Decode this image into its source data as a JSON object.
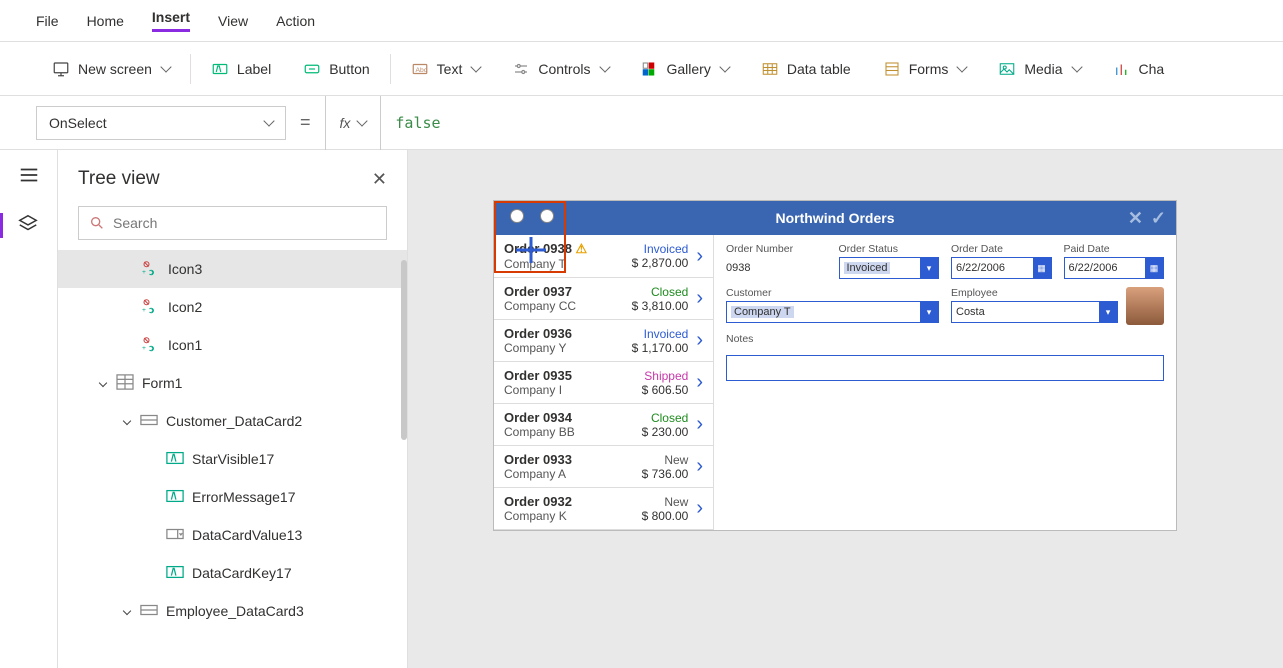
{
  "menu": {
    "items": [
      "File",
      "Home",
      "Insert",
      "View",
      "Action"
    ],
    "active_index": 2
  },
  "ribbon": {
    "new_screen": "New screen",
    "label": "Label",
    "button": "Button",
    "text": "Text",
    "controls": "Controls",
    "gallery": "Gallery",
    "data_table": "Data table",
    "forms": "Forms",
    "media": "Media",
    "charts": "Cha"
  },
  "formula": {
    "property": "OnSelect",
    "fx": "fx",
    "value": "false"
  },
  "tree": {
    "title": "Tree view",
    "search_placeholder": "Search",
    "items": [
      {
        "label": "Icon3",
        "depth": 2,
        "icon": "icon",
        "sel": true
      },
      {
        "label": "Icon2",
        "depth": 2,
        "icon": "icon"
      },
      {
        "label": "Icon1",
        "depth": 2,
        "icon": "icon"
      },
      {
        "label": "Form1",
        "depth": 1,
        "icon": "form",
        "expand": true
      },
      {
        "label": "Customer_DataCard2",
        "depth": 2,
        "icon": "card",
        "expand": true
      },
      {
        "label": "StarVisible17",
        "depth": 3,
        "icon": "labelctl"
      },
      {
        "label": "ErrorMessage17",
        "depth": 3,
        "icon": "labelctl"
      },
      {
        "label": "DataCardValue13",
        "depth": 3,
        "icon": "dropdown"
      },
      {
        "label": "DataCardKey17",
        "depth": 3,
        "icon": "labelctl"
      },
      {
        "label": "Employee_DataCard3",
        "depth": 2,
        "icon": "card",
        "expand": true
      }
    ]
  },
  "app": {
    "title": "Northwind Orders",
    "orders": [
      {
        "num": "Order 0938",
        "company": "Company T",
        "status": "Invoiced",
        "amount": "$ 2,870.00",
        "warn": true
      },
      {
        "num": "Order 0937",
        "company": "Company CC",
        "status": "Closed",
        "amount": "$ 3,810.00"
      },
      {
        "num": "Order 0936",
        "company": "Company Y",
        "status": "Invoiced",
        "amount": "$ 1,170.00"
      },
      {
        "num": "Order 0935",
        "company": "Company I",
        "status": "Shipped",
        "amount": "$ 606.50"
      },
      {
        "num": "Order 0934",
        "company": "Company BB",
        "status": "Closed",
        "amount": "$ 230.00"
      },
      {
        "num": "Order 0933",
        "company": "Company A",
        "status": "New",
        "amount": "$ 736.00"
      },
      {
        "num": "Order 0932",
        "company": "Company K",
        "status": "New",
        "amount": "$ 800.00"
      }
    ],
    "form": {
      "labels": {
        "order_number": "Order Number",
        "order_status": "Order Status",
        "order_date": "Order Date",
        "paid_date": "Paid Date",
        "customer": "Customer",
        "employee": "Employee",
        "notes": "Notes"
      },
      "values": {
        "order_number": "0938",
        "order_status": "Invoiced",
        "order_date": "6/22/2006",
        "paid_date": "6/22/2006",
        "customer": "Company T",
        "employee": "Costa"
      }
    }
  }
}
